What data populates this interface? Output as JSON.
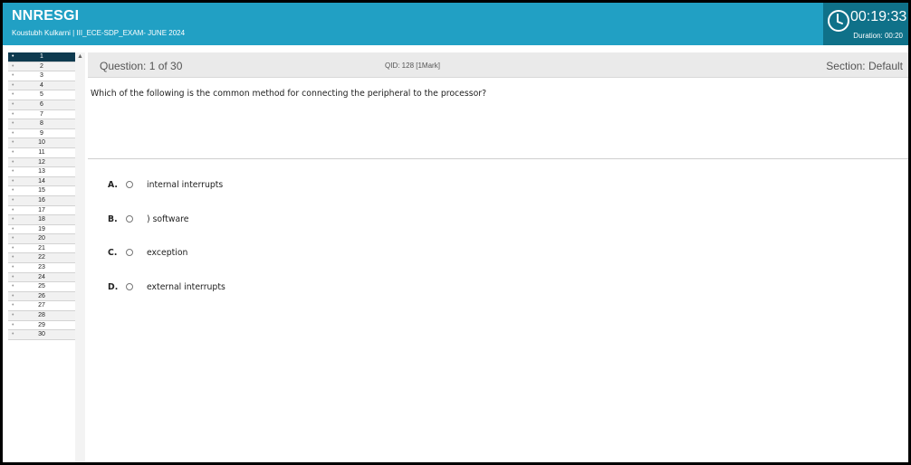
{
  "header": {
    "brand": "NNRESGI",
    "subtitle": "Koustubh Kulkarni | III_ECE-SDP_EXAM- JUNE 2024",
    "timer": "00:19:33",
    "duration": "Duration: 00:20"
  },
  "sidebar": {
    "questions": [
      "1",
      "2",
      "3",
      "4",
      "5",
      "6",
      "7",
      "8",
      "9",
      "10",
      "11",
      "12",
      "13",
      "14",
      "15",
      "16",
      "17",
      "18",
      "19",
      "20",
      "21",
      "22",
      "23",
      "24",
      "25",
      "26",
      "27",
      "28",
      "29",
      "30"
    ],
    "active_index": 0
  },
  "question_bar": {
    "number": "Question: 1 of 30",
    "qid": "QID: 128 [1Mark]",
    "section": "Section:  Default"
  },
  "question": {
    "text": "Which of the following is the common method for connecting the peripheral to the processor?"
  },
  "options": [
    {
      "letter": "A.",
      "text": "internal interrupts"
    },
    {
      "letter": "B.",
      "text": ") software"
    },
    {
      "letter": "C.",
      "text": "exception"
    },
    {
      "letter": "D.",
      "text": "external interrupts"
    }
  ],
  "colors": {
    "header_bg": "#21a0c4",
    "timer_bg": "#0f7189",
    "active_question_bg": "#0e3a4f"
  },
  "icons": {
    "timer": "clock-icon",
    "scroll": "scroll-up-arrow-icon"
  }
}
